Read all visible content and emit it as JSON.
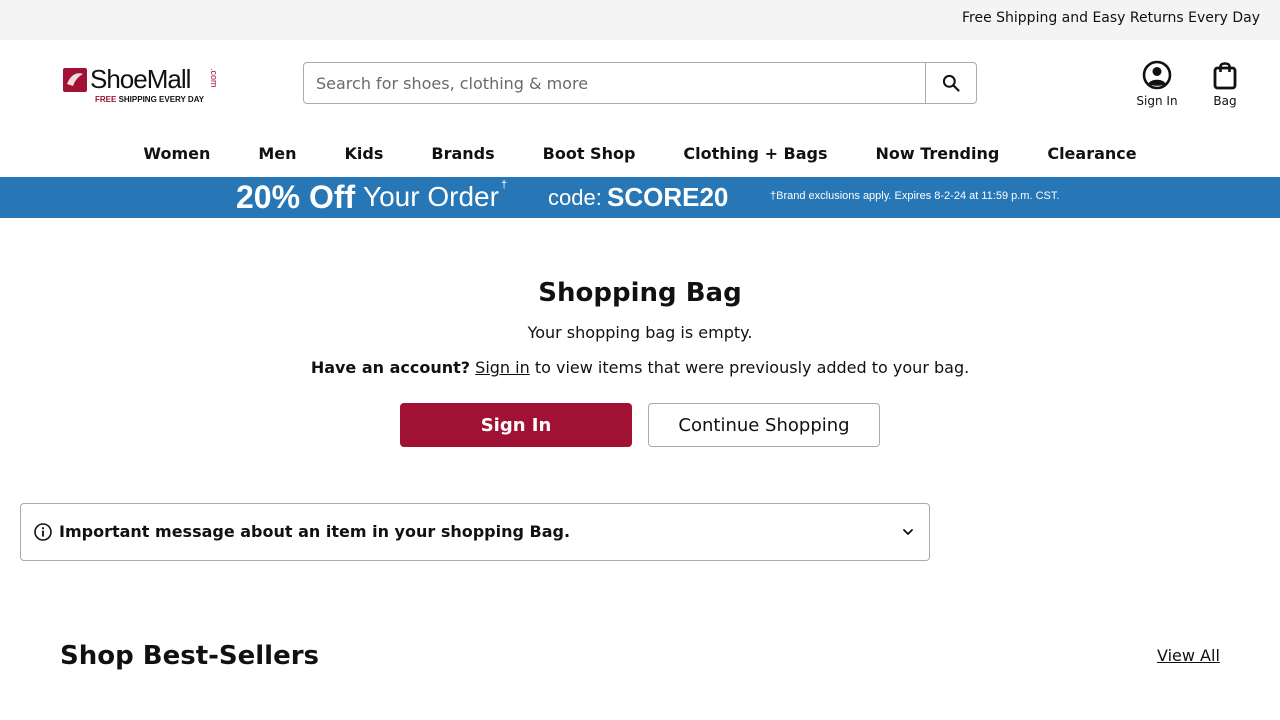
{
  "topbar": {
    "text": "Free Shipping and Easy Returns Every Day"
  },
  "logo": {
    "name": "ShoeMall",
    "com": ".com",
    "tag_free": "FREE",
    "tag_rest": " SHIPPING EVERY DAY"
  },
  "search": {
    "placeholder": "Search for shoes, clothing & more",
    "value": ""
  },
  "header_actions": {
    "sign_in": "Sign In",
    "bag": "Bag"
  },
  "nav": {
    "items": [
      "Women",
      "Men",
      "Kids",
      "Brands",
      "Boot Shop",
      "Clothing + Bags",
      "Now Trending",
      "Clearance"
    ]
  },
  "promo": {
    "big": "20% Off",
    "mid": "Your Order",
    "dagger": "†",
    "code_label": "code:",
    "code": "SCORE20",
    "fine_print": "†Brand exclusions apply. Expires 8-2-24 at 11:59 p.m. CST."
  },
  "main": {
    "title": "Shopping Bag",
    "empty_message": "Your shopping bag is empty.",
    "account_bold": "Have an account?",
    "account_link": "Sign in",
    "account_rest": "to view items that were previously added to your bag.",
    "sign_in_button": "Sign In",
    "continue_button": "Continue Shopping"
  },
  "notice": {
    "text": "Important message about an item in your shopping Bag."
  },
  "best_sellers": {
    "title": "Shop Best-Sellers",
    "view_all": "View All"
  },
  "colors": {
    "brand": "#a01134",
    "promo_bg": "#2776b5",
    "topbar_bg": "#f4f4f4"
  }
}
